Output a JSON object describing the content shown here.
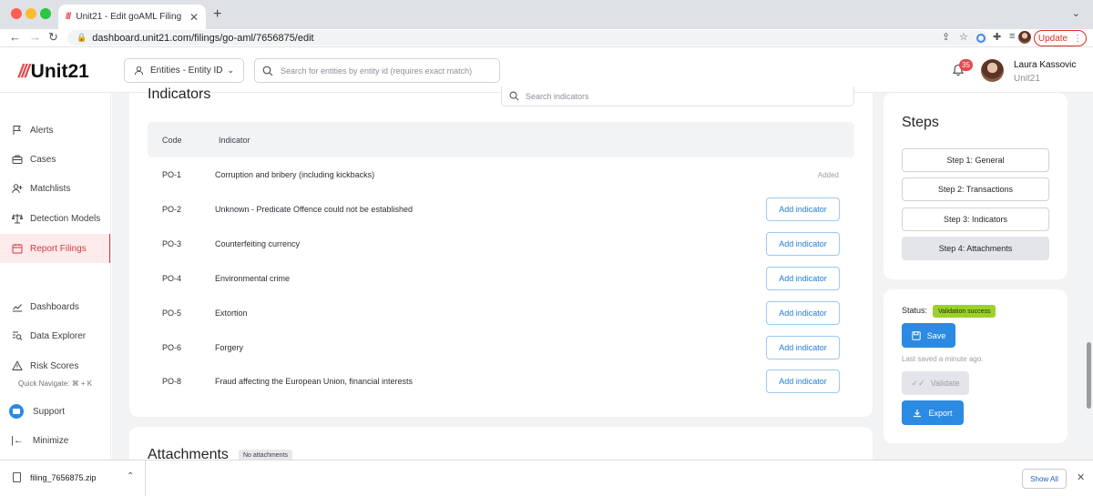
{
  "browser": {
    "tab_title": "Unit21 - Edit goAML Filing",
    "url": "dashboard.unit21.com/filings/go-aml/7656875/edit",
    "update_label": "Update"
  },
  "header": {
    "logo": "Unit21",
    "entity_selector": "Entities - Entity ID",
    "search_placeholder": "Search for entities by entity id (requires exact match)",
    "notification_count": "35",
    "user_name": "Laura Kassovic",
    "user_org": "Unit21"
  },
  "sidebar": {
    "items": [
      {
        "label": "Alerts"
      },
      {
        "label": "Cases"
      },
      {
        "label": "Matchlists"
      },
      {
        "label": "Detection Models"
      },
      {
        "label": "Report Filings"
      },
      {
        "label": "Dashboards"
      },
      {
        "label": "Data Explorer"
      },
      {
        "label": "Risk Scores"
      }
    ],
    "quick_navigate": "Quick Navigate: ⌘ + K",
    "support": "Support",
    "minimize": "Minimize"
  },
  "indicators": {
    "title": "Indicators",
    "search_placeholder": "Search indicators",
    "col_code": "Code",
    "col_indicator": "Indicator",
    "add_label": "Add indicator",
    "added_label": "Added",
    "rows": [
      {
        "code": "PO-1",
        "indicator": "Corruption and bribery (including kickbacks)",
        "added": true
      },
      {
        "code": "PO-2",
        "indicator": "Unknown - Predicate Offence could not be established",
        "added": false
      },
      {
        "code": "PO-3",
        "indicator": "Counterfeiting currency",
        "added": false
      },
      {
        "code": "PO-4",
        "indicator": "Environmental crime",
        "added": false
      },
      {
        "code": "PO-5",
        "indicator": "Extortion",
        "added": false
      },
      {
        "code": "PO-6",
        "indicator": "Forgery",
        "added": false
      },
      {
        "code": "PO-8",
        "indicator": "Fraud affecting the European Union, financial interests",
        "added": false
      }
    ]
  },
  "attachments": {
    "title": "Attachments",
    "badge": "No attachments"
  },
  "steps": {
    "title": "Steps",
    "items": [
      "Step 1: General",
      "Step 2: Transactions",
      "Step 3: Indicators",
      "Step 4: Attachments"
    ]
  },
  "status": {
    "label": "Status:",
    "badge": "Validation success",
    "save": "Save",
    "last_saved": "Last saved a minute ago.",
    "validate": "Validate",
    "export": "Export"
  },
  "downloads": {
    "file": "filing_7656875.zip",
    "show_all": "Show All"
  }
}
